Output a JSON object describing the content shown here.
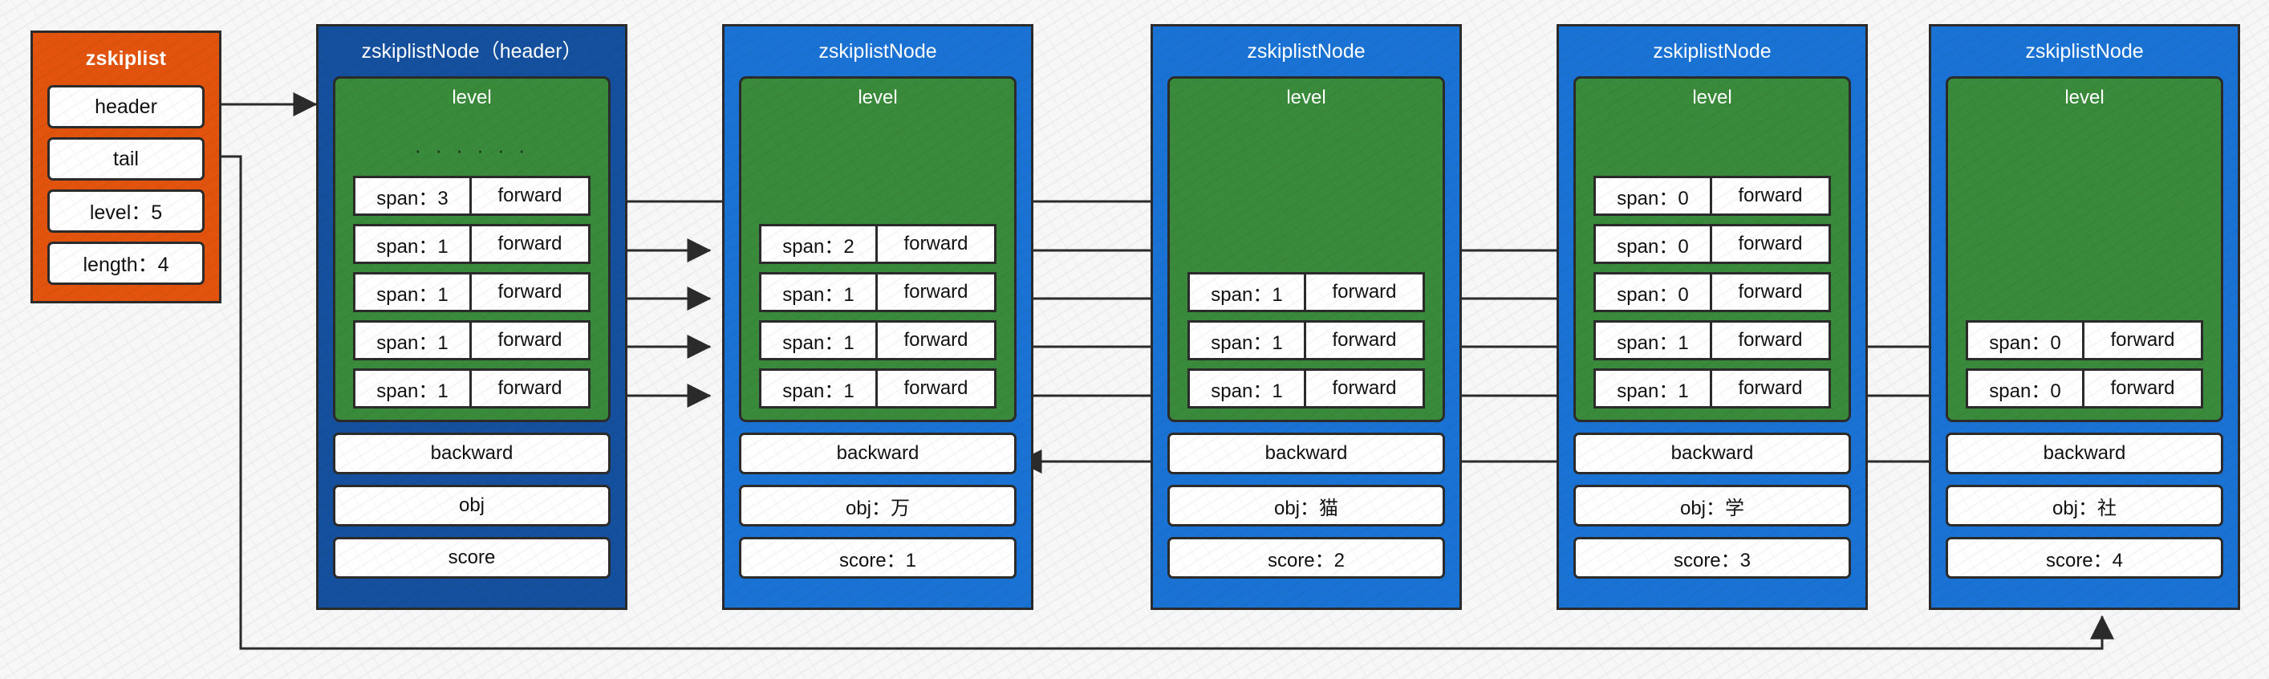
{
  "diagram": {
    "title": "Redis zskiplist structure",
    "colors": {
      "orange": "#e2540d",
      "header_blue": "#14509e",
      "node_blue": "#1a73d4",
      "level_green": "#3a8a3c",
      "stroke": "#2b2b2b",
      "background": "#f7f7f7"
    }
  },
  "zskiplist": {
    "title": "zskiplist",
    "fields": [
      {
        "label": "header"
      },
      {
        "label": "tail"
      },
      {
        "label": "level：5"
      },
      {
        "label": "length：4"
      }
    ]
  },
  "nodes": [
    {
      "title": "zskiplistNode（header）",
      "level_label": "level",
      "dots": "· · · · · ·",
      "levels": [
        {
          "span": "span：3",
          "forward": "forward"
        },
        {
          "span": "span：1",
          "forward": "forward"
        },
        {
          "span": "span：1",
          "forward": "forward"
        },
        {
          "span": "span：1",
          "forward": "forward"
        },
        {
          "span": "span：1",
          "forward": "forward"
        }
      ],
      "backward": "backward",
      "obj": "obj",
      "score": "score"
    },
    {
      "title": "zskiplistNode",
      "level_label": "level",
      "dots": "",
      "levels": [
        {
          "span": "span：2",
          "forward": "forward"
        },
        {
          "span": "span：1",
          "forward": "forward"
        },
        {
          "span": "span：1",
          "forward": "forward"
        },
        {
          "span": "span：1",
          "forward": "forward"
        }
      ],
      "backward": "backward",
      "obj": "obj：万",
      "score": "score：1"
    },
    {
      "title": "zskiplistNode",
      "level_label": "level",
      "dots": "",
      "levels": [
        {
          "span": "span：1",
          "forward": "forward"
        },
        {
          "span": "span：1",
          "forward": "forward"
        },
        {
          "span": "span：1",
          "forward": "forward"
        }
      ],
      "backward": "backward",
      "obj": "obj：猫",
      "score": "score：2"
    },
    {
      "title": "zskiplistNode",
      "level_label": "level",
      "dots": "",
      "levels": [
        {
          "span": "span：0",
          "forward": "forward"
        },
        {
          "span": "span：0",
          "forward": "forward"
        },
        {
          "span": "span：0",
          "forward": "forward"
        },
        {
          "span": "span：1",
          "forward": "forward"
        },
        {
          "span": "span：1",
          "forward": "forward"
        }
      ],
      "backward": "backward",
      "obj": "obj：学",
      "score": "score：3"
    },
    {
      "title": "zskiplistNode",
      "level_label": "level",
      "dots": "",
      "levels": [
        {
          "span": "span：0",
          "forward": "forward"
        },
        {
          "span": "span：0",
          "forward": "forward"
        }
      ],
      "backward": "backward",
      "obj": "obj：社",
      "score": "score：4"
    }
  ]
}
